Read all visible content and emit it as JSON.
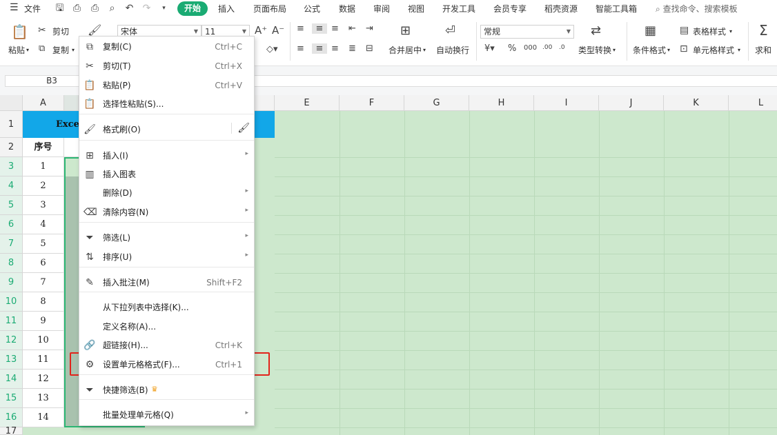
{
  "menubar": {
    "file_label": "文件",
    "tabs": [
      "开始",
      "插入",
      "页面布局",
      "公式",
      "数据",
      "审阅",
      "视图",
      "开发工具",
      "会员专享",
      "稻壳资源",
      "智能工具箱"
    ],
    "search_placeholder": "查找命令、搜索模板"
  },
  "ribbon": {
    "paste": "粘贴",
    "cut": "剪切",
    "copy": "复制",
    "font_name": "宋体",
    "font_size": "11",
    "merge_center": "合并居中",
    "wrap_text": "自动换行",
    "number_format": "常规",
    "type_convert": "类型转换",
    "cond_format": "条件格式",
    "table_style": "表格样式",
    "cell_style": "单元格样式",
    "sum": "求和"
  },
  "formula_bar": {
    "name_box": "B3"
  },
  "sheet": {
    "columns": [
      "A",
      "B",
      "C",
      "D",
      "E",
      "F",
      "G",
      "H",
      "I",
      "J",
      "K",
      "L"
    ],
    "rows": [
      "1",
      "2",
      "3",
      "4",
      "5",
      "6",
      "7",
      "8",
      "9",
      "10",
      "11",
      "12",
      "13",
      "14",
      "15",
      "16",
      "17"
    ],
    "title_cell": "Exce",
    "header_a2": "序号",
    "col_a_values": [
      "1",
      "2",
      "3",
      "4",
      "5",
      "6",
      "7",
      "8",
      "9",
      "10",
      "11",
      "12",
      "13",
      "14"
    ]
  },
  "context_menu": {
    "items": [
      {
        "label": "复制(C)",
        "shortcut": "Ctrl+C",
        "icon": "copy-icon"
      },
      {
        "label": "剪切(T)",
        "shortcut": "Ctrl+X",
        "icon": "scissors-icon"
      },
      {
        "label": "粘贴(P)",
        "shortcut": "Ctrl+V",
        "icon": "paste-icon"
      },
      {
        "label": "选择性粘贴(S)...",
        "shortcut": "",
        "icon": "paste-special-icon"
      },
      {
        "label": "格式刷(O)",
        "shortcut": "",
        "icon": "format-painter-icon"
      },
      {
        "label": "插入(I)",
        "shortcut": "",
        "icon": "insert-icon"
      },
      {
        "label": "插入图表",
        "shortcut": "",
        "icon": "chart-icon"
      },
      {
        "label": "删除(D)",
        "shortcut": "",
        "icon": ""
      },
      {
        "label": "清除内容(N)",
        "shortcut": "",
        "icon": "eraser-icon"
      },
      {
        "label": "筛选(L)",
        "shortcut": "",
        "icon": "filter-icon"
      },
      {
        "label": "排序(U)",
        "shortcut": "",
        "icon": "sort-icon"
      },
      {
        "label": "插入批注(M)",
        "shortcut": "Shift+F2",
        "icon": "comment-icon"
      },
      {
        "label": "从下拉列表中选择(K)...",
        "shortcut": "",
        "icon": ""
      },
      {
        "label": "定义名称(A)...",
        "shortcut": "",
        "icon": ""
      },
      {
        "label": "超链接(H)...",
        "shortcut": "Ctrl+K",
        "icon": "link-icon"
      },
      {
        "label": "设置单元格格式(F)...",
        "shortcut": "Ctrl+1",
        "icon": "format-cells-icon"
      },
      {
        "label": "快捷筛选(B)",
        "shortcut": "",
        "icon": "quick-filter-icon"
      },
      {
        "label": "批量处理单元格(Q)",
        "shortcut": "",
        "icon": ""
      }
    ]
  }
}
